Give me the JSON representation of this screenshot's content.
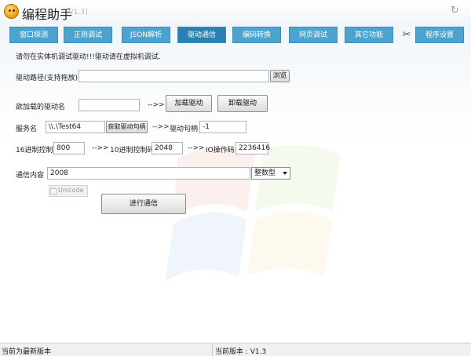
{
  "app": {
    "title": "编程助手",
    "version": "[V1.3]"
  },
  "tabs": [
    "窗口探测",
    "正则调试",
    "JSON解析",
    "驱动通信",
    "编码转换",
    "网页调试",
    "其它功能",
    "程序设置"
  ],
  "notice": "请勿在实体机调试驱动!!!驱动请在虚拟机调试.",
  "driver_path": {
    "label": "驱动路径(支持拖放)",
    "value": "",
    "browse_label": "浏览"
  },
  "load": {
    "label": "欲加载的驱动名",
    "value": "",
    "arrow": "-->>",
    "load_label": "加载驱动",
    "unload_label": "卸载驱动"
  },
  "service": {
    "label": "服务名",
    "value": "\\\\.\\Test64",
    "get_handle_label": "获取驱动句柄",
    "arrow": "-->>",
    "handle_label": "驱动句柄",
    "handle_value": "-1"
  },
  "ctl": {
    "hex_label": "16进制控制码",
    "hex_value": "800",
    "arrow1": "-->>",
    "dec_label": "10进制控制码",
    "dec_value": "2048",
    "arrow2": "-->>",
    "io_label": "IO操作码",
    "io_value": "2236416"
  },
  "comm": {
    "label": "通信内容",
    "value": "2008",
    "type_selected": "整数型",
    "unicode_label": "Unicode",
    "send_label": "进行通信"
  },
  "status": {
    "left": "当前为最新版本",
    "right": "当前版本 : V1.3"
  },
  "colors": {
    "tab": "#4da3cf",
    "tab_active": "#2c7fb3"
  }
}
